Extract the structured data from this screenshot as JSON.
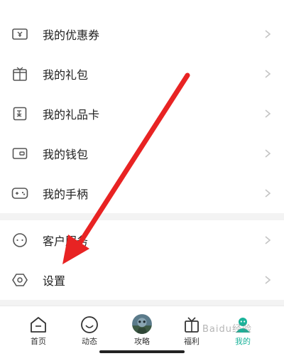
{
  "menu": {
    "items": [
      {
        "label": "我的优惠券",
        "icon": "coupon-icon"
      },
      {
        "label": "我的礼包",
        "icon": "gift-pack-icon"
      },
      {
        "label": "我的礼品卡",
        "icon": "gift-card-icon"
      },
      {
        "label": "我的钱包",
        "icon": "wallet-icon"
      },
      {
        "label": "我的手柄",
        "icon": "gamepad-icon"
      }
    ],
    "items2": [
      {
        "label": "客户服务",
        "icon": "customer-service-icon"
      },
      {
        "label": "设置",
        "icon": "settings-icon"
      }
    ]
  },
  "tabbar": {
    "tabs": [
      {
        "label": "首页",
        "icon": "home-icon"
      },
      {
        "label": "动态",
        "icon": "activity-icon"
      },
      {
        "label": "攻略",
        "icon": "avatar-icon"
      },
      {
        "label": "福利",
        "icon": "gift-box-icon"
      },
      {
        "label": "我的",
        "icon": "profile-icon",
        "active": true
      }
    ]
  },
  "watermark": {
    "text": "Baidu经验"
  },
  "colors": {
    "accent": "#1ab39a",
    "arrow": "#e82323",
    "icon": "#555555",
    "chevron": "#c4c4c4",
    "separator": "#f3f3f3"
  }
}
